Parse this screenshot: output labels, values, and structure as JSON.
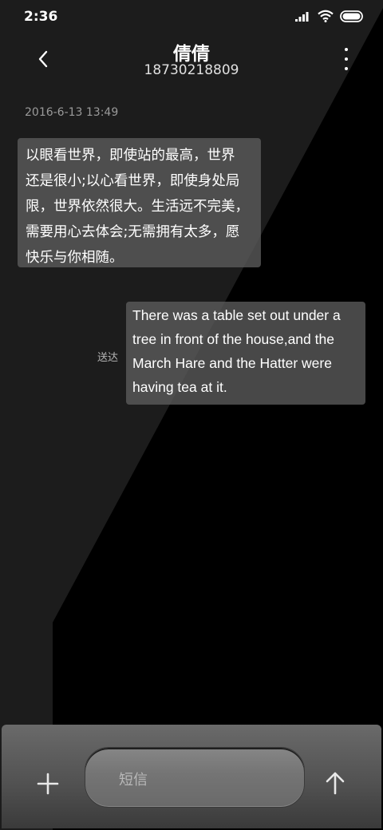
{
  "status_bar": {
    "time": "2:36"
  },
  "header": {
    "contact_name": "倩倩",
    "contact_number": "18730218809"
  },
  "conversation": {
    "timestamp": "2016-6-13 13:49",
    "messages": [
      {
        "direction": "incoming",
        "text": "以眼看世界，即使站的最高，世界\n还是很小;以心看世界，即使身处局\n限，世界依然很大。生活远不完美，\n需要用心去体会;无需拥有太多，愿\n快乐与你相随。"
      },
      {
        "direction": "outgoing",
        "text": "There was a table set out under a tree in front of the house,and the March Hare and the Hatter were having tea at it.",
        "status": "送达"
      }
    ]
  },
  "compose": {
    "placeholder": "短信"
  },
  "colors": {
    "background": "#000000",
    "bubble": "#5c5c5c",
    "compose_bar": "#5a5a5a"
  }
}
